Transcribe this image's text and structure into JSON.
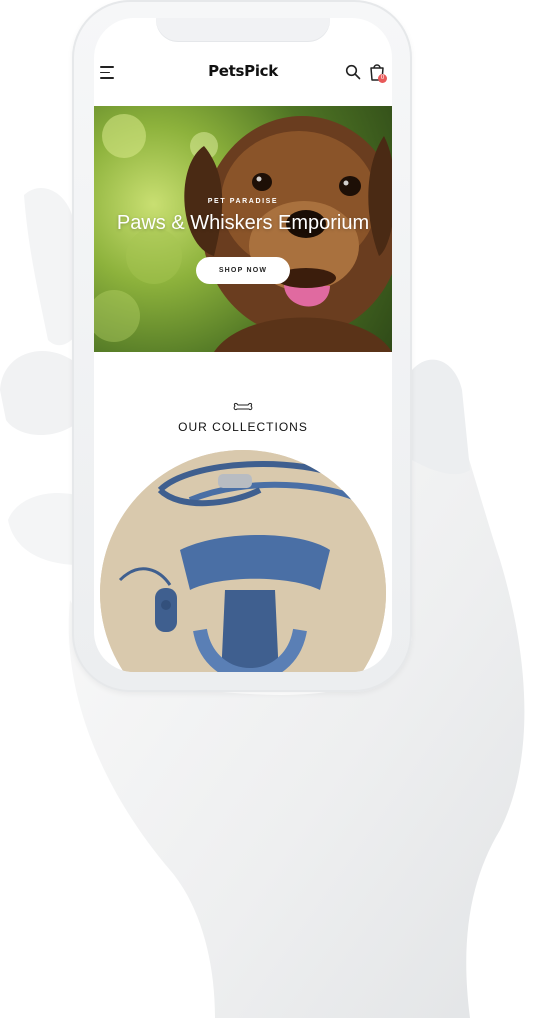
{
  "header": {
    "logo": "PetsPick",
    "cart_count": "0",
    "icons": [
      "menu-icon",
      "search-icon",
      "shopping-bag-icon"
    ]
  },
  "hero": {
    "eyebrow": "PET PARADISE",
    "title": "Paws & Whiskers Emporium",
    "button_label": "SHOP NOW"
  },
  "collections": {
    "title": "OUR COLLECTIONS",
    "icon": "bone-icon"
  },
  "colors": {
    "badge": "#e85a5a",
    "hero_green": "#8db23c",
    "product_blue": "#4a6fa5"
  }
}
